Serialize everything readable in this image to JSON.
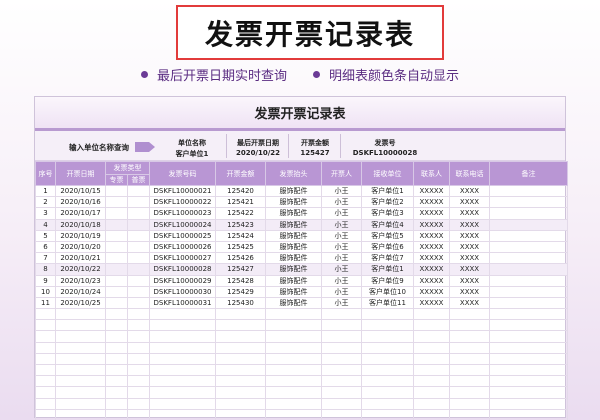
{
  "banner": {
    "title": "发票开票记录表"
  },
  "features": [
    {
      "text": "最后开票日期实时查询"
    },
    {
      "text": "明细表颜色条自动显示"
    }
  ],
  "sheet": {
    "title": "发票开票记录表",
    "query": {
      "label": "输入单位名称查询",
      "fields": [
        {
          "header": "单位名称",
          "value": "客户单位1"
        },
        {
          "header": "最后开票日期",
          "value": "2020/10/22"
        },
        {
          "header": "开票金额",
          "value": "125427"
        },
        {
          "header": "发票号",
          "value": "DSKFL10000028"
        }
      ]
    },
    "table": {
      "headers": [
        "序号",
        "开票日期",
        "发票类型",
        "发票号码",
        "开票金额",
        "发票抬头",
        "开票人",
        "接收单位",
        "联系人",
        "联系电话",
        "备注"
      ],
      "subheaders": [
        "专票",
        "普票"
      ],
      "rows": [
        [
          "1",
          "2020/10/15",
          "DSKFL10000021",
          "125420",
          "服饰配件",
          "小王",
          "客户单位1",
          "XXXXX",
          "XXXX"
        ],
        [
          "2",
          "2020/10/16",
          "DSKFL10000022",
          "125421",
          "服饰配件",
          "小王",
          "客户单位2",
          "XXXXX",
          "XXXX"
        ],
        [
          "3",
          "2020/10/17",
          "DSKFL10000023",
          "125422",
          "服饰配件",
          "小王",
          "客户单位3",
          "XXXXX",
          "XXXX"
        ],
        [
          "4",
          "2020/10/18",
          "DSKFL10000024",
          "125423",
          "服饰配件",
          "小王",
          "客户单位4",
          "XXXXX",
          "XXXX"
        ],
        [
          "5",
          "2020/10/19",
          "DSKFL10000025",
          "125424",
          "服饰配件",
          "小王",
          "客户单位5",
          "XXXXX",
          "XXXX"
        ],
        [
          "6",
          "2020/10/20",
          "DSKFL10000026",
          "125425",
          "服饰配件",
          "小王",
          "客户单位6",
          "XXXXX",
          "XXXX"
        ],
        [
          "7",
          "2020/10/21",
          "DSKFL10000027",
          "125426",
          "服饰配件",
          "小王",
          "客户单位7",
          "XXXXX",
          "XXXX"
        ],
        [
          "8",
          "2020/10/22",
          "DSKFL10000028",
          "125427",
          "服饰配件",
          "小王",
          "客户单位1",
          "XXXXX",
          "XXXX"
        ],
        [
          "9",
          "2020/10/23",
          "DSKFL10000029",
          "125428",
          "服饰配件",
          "小王",
          "客户单位9",
          "XXXXX",
          "XXXX"
        ],
        [
          "10",
          "2020/10/24",
          "DSKFL10000030",
          "125429",
          "服饰配件",
          "小王",
          "客户单位10",
          "XXXXX",
          "XXXX"
        ],
        [
          "11",
          "2020/10/25",
          "DSKFL10000031",
          "125430",
          "服饰配件",
          "小王",
          "客户单位11",
          "XXXXX",
          "XXXX"
        ]
      ],
      "highlight_rows": [
        4,
        8
      ]
    }
  },
  "colors": {
    "accent": "#b996d4",
    "banner_border": "#e23b3b",
    "feature_text": "#5b2d82"
  }
}
